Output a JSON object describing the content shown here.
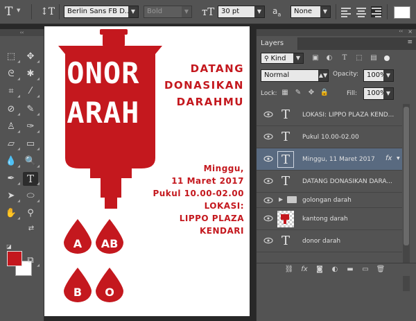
{
  "options_bar": {
    "font_family": "Berlin Sans FB D...",
    "font_style": "Bold",
    "font_size": "30 pt",
    "aa_label": "a",
    "aa_sub": "a",
    "antialias": "None"
  },
  "layers_panel": {
    "tab": "Layers",
    "filter_kind": "Kind",
    "blend_mode": "Normal",
    "opacity_label": "Opacity:",
    "opacity_value": "100%",
    "lock_label": "Lock:",
    "fill_label": "Fill:",
    "fill_value": "100%",
    "layers": [
      {
        "name": "LOKASI: LIPPO PLAZA KEND...",
        "type": "text",
        "selected": false
      },
      {
        "name": "Pukul 10.00-02.00",
        "type": "text",
        "selected": false
      },
      {
        "name": "Minggu,  11 Maret 2017",
        "type": "text",
        "selected": true,
        "fx": "fx"
      },
      {
        "name": "DATANG DONASIKAN DARA...",
        "type": "text",
        "selected": false
      },
      {
        "name": "golongan darah",
        "type": "group",
        "selected": false
      },
      {
        "name": "kantong darah",
        "type": "image",
        "selected": false
      },
      {
        "name": "donor darah",
        "type": "text",
        "selected": false
      }
    ],
    "footer_fx": "fx"
  },
  "poster": {
    "title_line1": "DONOR",
    "title_line2": "DARAH",
    "headline": [
      "DATANG",
      "DONASIKAN",
      "DARAHMU"
    ],
    "date_line1": "Minggu,",
    "date_line2": "11 Maret 2017",
    "time": "Pukul 10.00-02.00",
    "location": [
      "LOKASI:",
      "LIPPO PLAZA",
      "KENDARI"
    ],
    "blood_types": [
      "A",
      "AB",
      "B",
      "O"
    ]
  },
  "colors": {
    "blood_red": "#c4181e",
    "selected_layer": "#596a80",
    "panel_bg": "#535353"
  }
}
